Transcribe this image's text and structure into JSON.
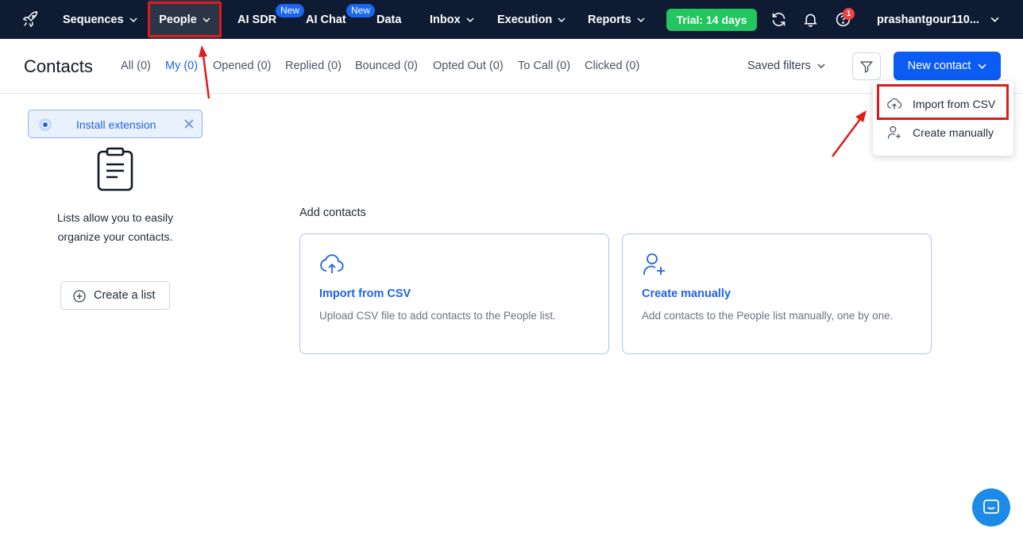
{
  "nav": {
    "items": [
      {
        "label": "Sequences"
      },
      {
        "label": "People"
      },
      {
        "label": "AI SDR",
        "badge": "New"
      },
      {
        "label": "AI Chat",
        "badge": "New"
      },
      {
        "label": "Data"
      },
      {
        "label": "Inbox"
      },
      {
        "label": "Execution"
      },
      {
        "label": "Reports"
      }
    ],
    "trial_label": "Trial: 14 days",
    "notification_count": "1",
    "username": "prashantgour110..."
  },
  "header": {
    "title": "Contacts",
    "tabs": [
      {
        "label": "All (0)"
      },
      {
        "label": "My (0)"
      },
      {
        "label": "Opened (0)"
      },
      {
        "label": "Replied (0)"
      },
      {
        "label": "Bounced (0)"
      },
      {
        "label": "Opted Out (0)"
      },
      {
        "label": "To Call (0)"
      },
      {
        "label": "Clicked (0)"
      }
    ],
    "saved_filters_label": "Saved filters",
    "new_contact_label": "New contact"
  },
  "dropdown": {
    "items": [
      {
        "label": "Import from CSV"
      },
      {
        "label": "Create manually"
      }
    ]
  },
  "sidebar": {
    "extension_label": "Install extension",
    "description": "Lists allow you to easily organize your contacts.",
    "create_list_label": "Create a list"
  },
  "main": {
    "title": "Add contacts",
    "cards": [
      {
        "title": "Import from CSV",
        "description": "Upload CSV file to add contacts to the People list."
      },
      {
        "title": "Create manually",
        "description": "Add contacts to the People list manually, one by one."
      }
    ]
  },
  "colors": {
    "nav_bg": "#0f1a33",
    "accent": "#0b5cf2",
    "trial": "#22c55e",
    "highlight": "#dc1c1c"
  }
}
